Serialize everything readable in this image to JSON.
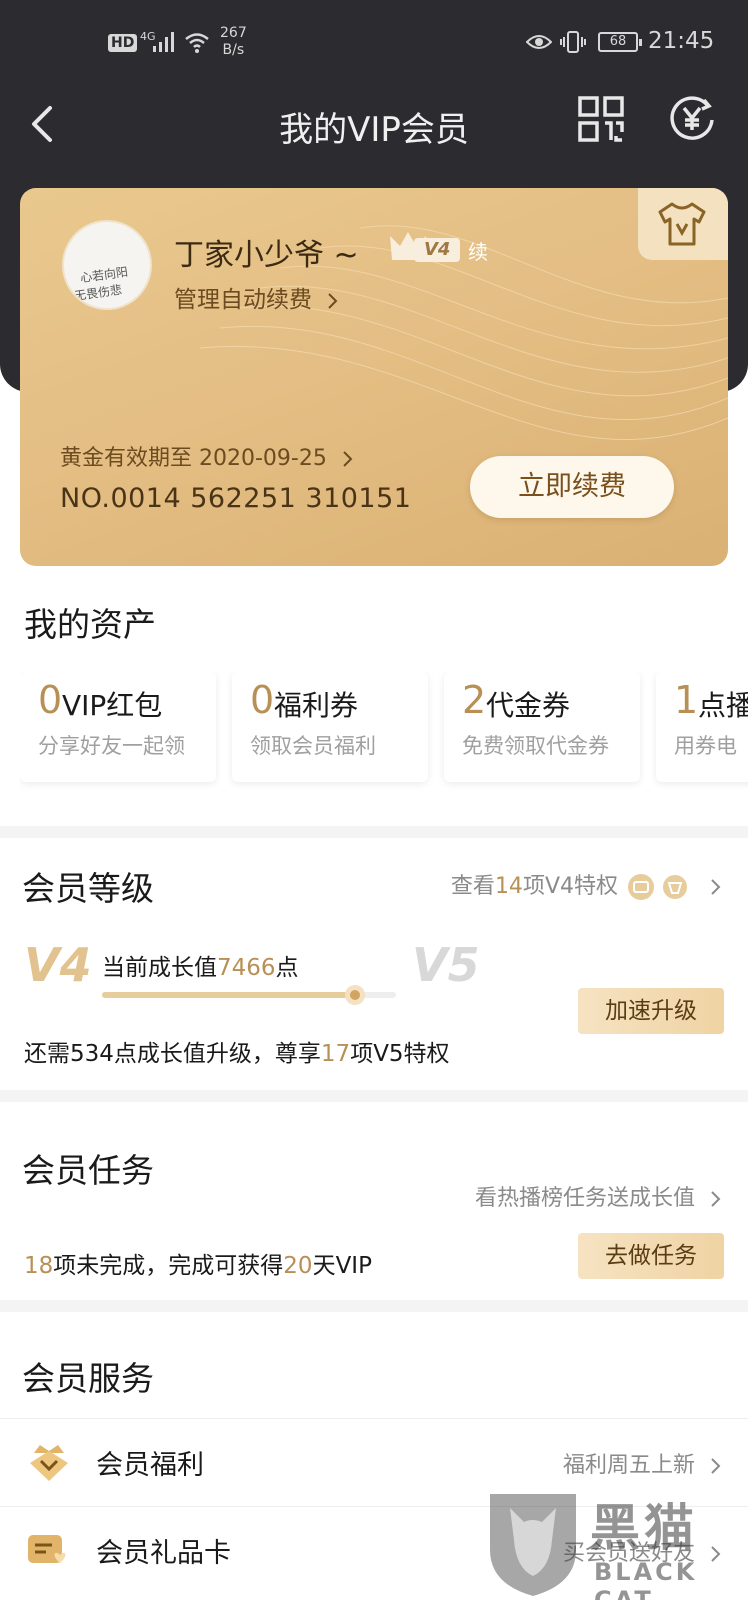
{
  "status_bar": {
    "hd": "HD",
    "net": "4G",
    "speed_value": "267",
    "speed_unit": "B/s",
    "battery": "68",
    "time": "21:45"
  },
  "nav": {
    "title": "我的VIP会员"
  },
  "member_card": {
    "username": "丁家小少爷 ~",
    "level_badge": "V4",
    "renew_tag": "续",
    "manage_link": "管理自动续费",
    "expiry": "黄金有效期至 2020-09-25",
    "card_number": "NO.0014 562251 310151",
    "renew_button": "立即续费",
    "avatar_line1": "心若向阳",
    "avatar_line2": "无畏伤悲"
  },
  "assets": {
    "title": "我的资产",
    "items": [
      {
        "count": "0",
        "name": "VIP红包",
        "sub": "分享好友一起领"
      },
      {
        "count": "0",
        "name": "福利券",
        "sub": "领取会员福利"
      },
      {
        "count": "2",
        "name": "代金券",
        "sub": "免费领取代金券"
      },
      {
        "count": "1",
        "name": "点播",
        "sub": "用券电"
      }
    ]
  },
  "level": {
    "title": "会员等级",
    "see_prefix": "查看",
    "see_count": "14",
    "see_suffix": "项V4特权",
    "current_level": "V4",
    "next_level": "V5",
    "growth_prefix": "当前成长值",
    "growth_value": "7466",
    "growth_suffix": "点",
    "progress_fraction": 0.86,
    "need_prefix": "还需534点成长值升级，尊享",
    "need_count": "17",
    "need_suffix": "项V5特权",
    "speed_button": "加速升级"
  },
  "tasks": {
    "title": "会员任务",
    "link": "看热播榜任务送成长值",
    "count": "18",
    "info_mid": "项未完成，完成可获得",
    "days": "20",
    "info_end": "天VIP",
    "button": "去做任务"
  },
  "services": {
    "title": "会员服务",
    "items": [
      {
        "name": "会员福利",
        "right": "福利周五上新",
        "icon": "crown-heart-icon"
      },
      {
        "name": "会员礼品卡",
        "right": "买会员送好友",
        "icon": "gift-card-icon"
      }
    ]
  },
  "watermark": {
    "cn": "黑猫",
    "en": "BLACK CAT"
  },
  "colors": {
    "dark_header": "#2c2c30",
    "gold_card": "#e4be84",
    "gold_text": "#b89056",
    "gray_text": "#8a8a8a"
  }
}
